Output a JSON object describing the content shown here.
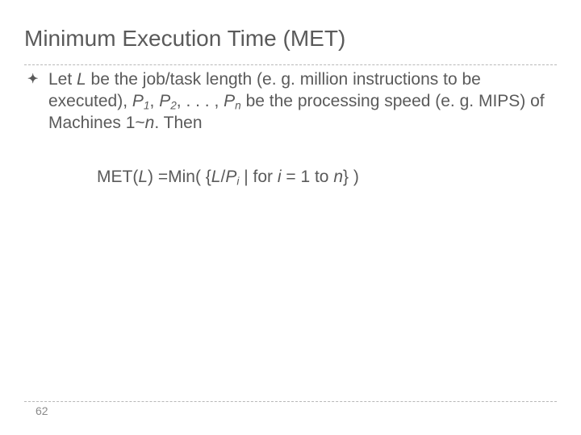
{
  "title": "Minimum Execution Time (MET)",
  "bullet_marker": "✦",
  "body_html": "Let <span class=\"it\">L</span> be the job/task length (e. g. million instructions to be executed), <span class=\"it\">P</span><sub class=\"sm\">1</sub>, <span class=\"it\">P</span><sub class=\"sm\">2</sub>, . . . , <span class=\"it\">P</span><sub class=\"sm\">n</sub> be the processing speed (e. g. MIPS) of Machines 1~<span class=\"it\">n</span>. Then",
  "formula_html": "MET(<span class=\"it\">L</span>) =Min( {<span class=\"it\">L</span>/<span class=\"it\">P</span><sub class=\"sm\">i</sub> | for <span class=\"it\">i</span> = 1 to <span class=\"it\">n</span>} )",
  "page_number": "62"
}
